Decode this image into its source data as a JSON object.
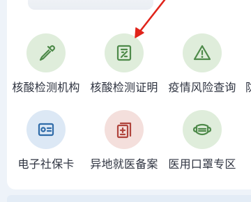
{
  "services": [
    {
      "label": "核酸检测机构",
      "icon": "dropper-icon",
      "color": "#4e8a4a",
      "bg": "green"
    },
    {
      "label": "核酸检测证明",
      "icon": "certificate-icon",
      "color": "#4e8a4a",
      "bg": "green"
    },
    {
      "label": "疫情风险查询",
      "icon": "warning-icon",
      "color": "#4e8a4a",
      "bg": "green"
    },
    {
      "label": "电子社保卡",
      "icon": "id-card-icon",
      "color": "#2f6ba8",
      "bg": "blue"
    },
    {
      "label": "异地就医备案",
      "icon": "medical-record-icon",
      "color": "#b0443c",
      "bg": "red"
    },
    {
      "label": "医用口罩专区",
      "icon": "mask-icon",
      "color": "#4e8a4a",
      "bg": "green"
    }
  ],
  "clipped_next_label": "防",
  "annotation": {
    "color": "#e0241b"
  }
}
